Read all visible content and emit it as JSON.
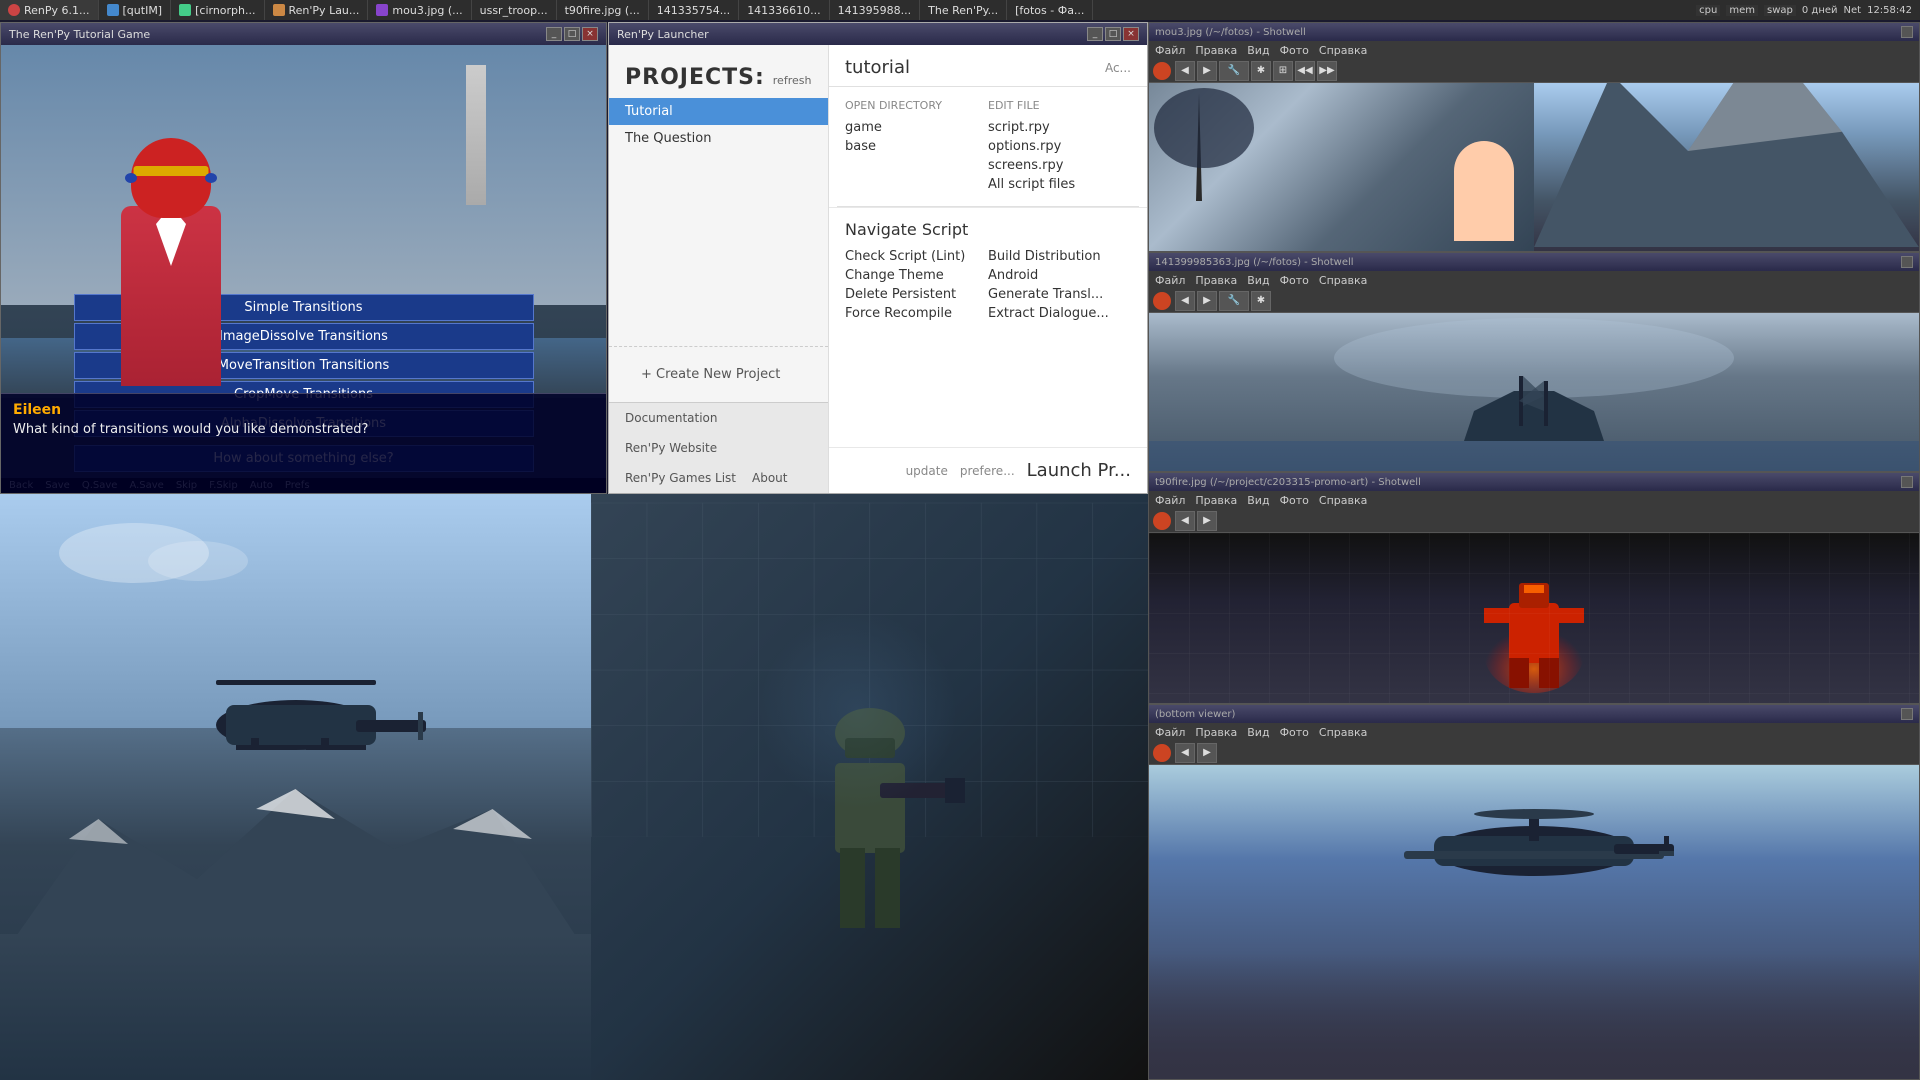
{
  "taskbar": {
    "items": [
      {
        "label": "RenPy 6.1...",
        "icon": "renpy-icon"
      },
      {
        "label": "[qutIM]",
        "icon": "chat-icon"
      },
      {
        "label": "[cirnorph...",
        "icon": "app-icon"
      },
      {
        "label": "Ren'Py Lau...",
        "icon": "renpy-icon"
      },
      {
        "label": "mou3.jpg (...",
        "icon": "image-icon"
      },
      {
        "label": "ussr_troop...",
        "icon": "image-icon"
      },
      {
        "label": "t90fire.jpg (...",
        "icon": "image-icon"
      },
      {
        "label": "141335754...",
        "icon": "image-icon"
      },
      {
        "label": "141336610...",
        "icon": "image-icon"
      },
      {
        "label": "141395988...",
        "icon": "image-icon"
      },
      {
        "label": "The Ren'Py...",
        "icon": "renpy-icon"
      },
      {
        "label": "[fotos - Фа...",
        "icon": "folder-icon"
      }
    ],
    "systray": {
      "clock": "12:58:42",
      "date": "0 дней",
      "network": "Net"
    }
  },
  "game_window": {
    "title": "The Ren'Py Tutorial Game",
    "menu_items": [
      {
        "label": "Simple Transitions"
      },
      {
        "label": "ImageDissolve Transitions"
      },
      {
        "label": "MoveTransition Transitions"
      },
      {
        "label": "CropMove Transitions"
      },
      {
        "label": "AlphaDissolve Transitions"
      },
      {
        "label": "How about something else?"
      }
    ],
    "character": {
      "name": "Eileen",
      "dialogue": "What kind of transitions would you like demonstrated?"
    },
    "controls": [
      "Back",
      "Save",
      "Q.Save",
      "A.Save",
      "Skip",
      "F.Skip",
      "Auto",
      "Prefs"
    ]
  },
  "launcher": {
    "title": "Ren'Py Launcher",
    "projects_label": "PROJECTS:",
    "refresh_label": "refresh",
    "projects": [
      {
        "name": "Tutorial",
        "active": true
      },
      {
        "name": "The Question",
        "active": false
      }
    ],
    "create_project_label": "+ Create New Project",
    "current_project": {
      "name": "tutorial",
      "actions_label": "Ac..."
    },
    "open_directory": {
      "title": "Open Directory",
      "items": [
        "game",
        "base"
      ]
    },
    "edit_file": {
      "title": "Edit File",
      "items": [
        "script.rpy",
        "options.rpy",
        "screens.rpy",
        "All script files"
      ]
    },
    "navigate_script": {
      "title": "Navigate Script"
    },
    "left_actions": [
      {
        "label": "Check Script (Lint)"
      },
      {
        "label": "Change Theme"
      },
      {
        "label": "Delete Persistent"
      },
      {
        "label": "Force Recompile"
      }
    ],
    "right_actions": [
      {
        "label": "Build Distribution"
      },
      {
        "label": "Android"
      },
      {
        "label": "Generate Transl..."
      },
      {
        "label": "Extract Dialogue..."
      }
    ],
    "launch_label": "Launch Pr...",
    "footer_links": [
      {
        "label": "Documentation"
      },
      {
        "label": "Ren'Py Website"
      },
      {
        "label": "Ren'Py Games List"
      },
      {
        "label": "About"
      }
    ],
    "footer_right": {
      "update": "update",
      "preferences": "prefere..."
    }
  },
  "shotwall_1": {
    "title": "mou3.jpg (/~/fotos) - Shotwell",
    "menubar": [
      "Файл",
      "Правка",
      "Вид",
      "Фото",
      "Справка"
    ]
  },
  "shotwall_2": {
    "title": "141399985363.jpg (/~/fotos) - Shotwell",
    "menubar": [
      "Файл",
      "Правка",
      "Вид",
      "Фото",
      "Справка"
    ]
  },
  "shotwall_3": {
    "title": "t90fire.jpg (/~/project/c203315-promo-art) - Shotwell",
    "menubar": [
      "Файл",
      "Правка",
      "Вид",
      "Фото",
      "Справка"
    ]
  },
  "shotwall_4": {
    "title": "(bottom viewer)",
    "menubar": [
      "Файл",
      "Правка",
      "Вид",
      "Фото",
      "Справка"
    ]
  }
}
